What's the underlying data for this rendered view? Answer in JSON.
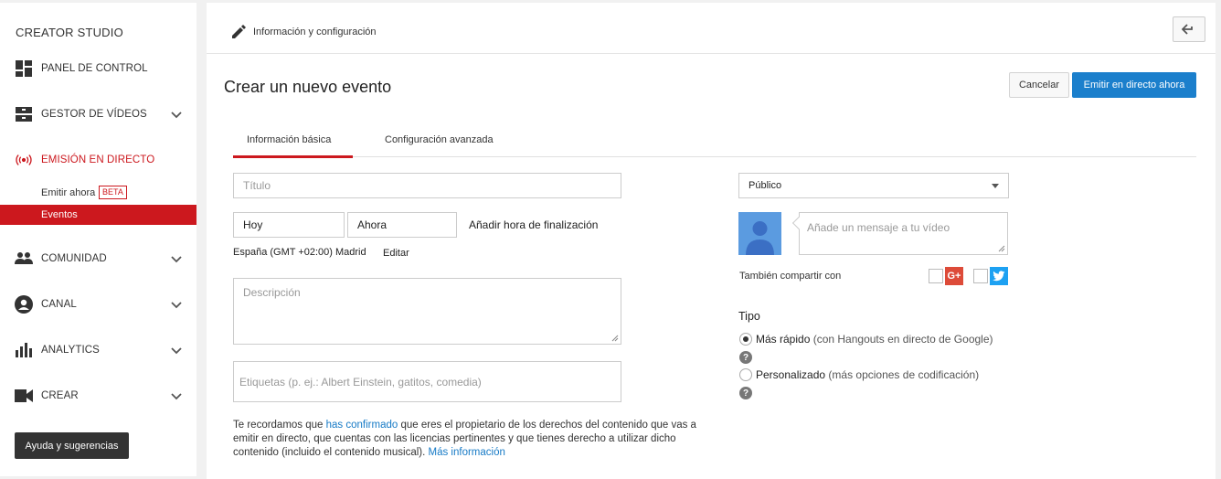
{
  "sidebar": {
    "brand": "CREATOR STUDIO",
    "items": [
      {
        "label": "PANEL DE CONTROL"
      },
      {
        "label": "GESTOR DE VÍDEOS"
      },
      {
        "label": "EMISIÓN EN DIRECTO"
      },
      {
        "label": "COMUNIDAD"
      },
      {
        "label": "CANAL"
      },
      {
        "label": "ANALYTICS"
      },
      {
        "label": "CREAR"
      }
    ],
    "subitems": [
      {
        "label": "Emitir ahora",
        "badge": "BETA"
      },
      {
        "label": "Eventos"
      }
    ],
    "help": "Ayuda y sugerencias"
  },
  "topbar": {
    "title": "Información y configuración"
  },
  "page": {
    "title": "Crear un nuevo evento",
    "cancel": "Cancelar",
    "go_live": "Emitir en directo ahora"
  },
  "tabs": [
    {
      "label": "Información básica"
    },
    {
      "label": "Configuración avanzada"
    }
  ],
  "form": {
    "title_placeholder": "Título",
    "date": "Hoy",
    "time": "Ahora",
    "add_end_time": "Añadir hora de finalización",
    "timezone": "España (GMT +02:00) Madrid",
    "edit": "Editar",
    "description_placeholder": "Descripción",
    "tags_placeholder": "Etiquetas (p. ej.: Albert Einstein, gatitos, comedia)"
  },
  "right": {
    "privacy": "Público",
    "message_placeholder": "Añade un mensaje a tu vídeo",
    "share_label": "También compartir con",
    "tipo_label": "Tipo",
    "option1_bold": "Más rápido",
    "option1_rest": " (con Hangouts en directo de Google)",
    "option2_bold": "Personalizado",
    "option2_rest": " (más opciones de codificación)",
    "help_glyph": "?"
  },
  "notice": {
    "part1": "Te recordamos que ",
    "link1": "has confirmado",
    "part2": " que eres el propietario de los derechos del contenido que vas a emitir en directo, que cuentas con las licencias pertinentes y que tienes derecho a utilizar dicho contenido (incluido el contenido musical). ",
    "link2": "Más información"
  },
  "colors": {
    "accent_red": "#cc181e",
    "accent_blue": "#1b7fcc",
    "gplus": "#dd4b39",
    "twitter": "#1da1f2"
  }
}
